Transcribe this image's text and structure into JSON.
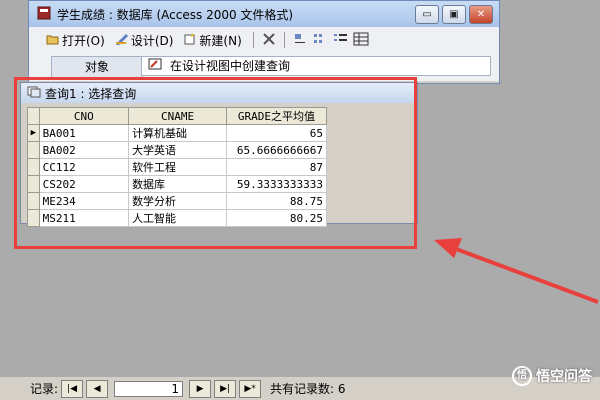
{
  "db_window": {
    "title": "学生成绩 : 数据库 (Access 2000 文件格式)",
    "buttons": {
      "minimize": "▭",
      "maximize": "▣",
      "close": "✕"
    },
    "toolbar": {
      "open_label": "打开(O)",
      "design_label": "设计(D)",
      "new_label": "新建(N)"
    },
    "objects_label": "对象",
    "objects_entry": "在设计视图中创建查询"
  },
  "query_window": {
    "title": "查询1 : 选择查询",
    "columns": [
      "CNO",
      "CNAME",
      "GRADE之平均值"
    ],
    "rows": [
      {
        "cno": "BA001",
        "cname": "计算机基础",
        "avg": "65"
      },
      {
        "cno": "BA002",
        "cname": "大学英语",
        "avg": "65.6666666667"
      },
      {
        "cno": "CC112",
        "cname": "软件工程",
        "avg": "87"
      },
      {
        "cno": "CS202",
        "cname": "数据库",
        "avg": "59.3333333333"
      },
      {
        "cno": "ME234",
        "cname": "数学分析",
        "avg": "88.75"
      },
      {
        "cno": "MS211",
        "cname": "人工智能",
        "avg": "80.25"
      }
    ]
  },
  "nav_bar": {
    "record_label": "记录:",
    "current_record": "1",
    "total_label": "共有记录数: 6"
  },
  "watermark": {
    "text": "悟空问答",
    "logo": "悟"
  },
  "colors": {
    "annotation": "#e8403c",
    "workspace": "#ababab"
  }
}
